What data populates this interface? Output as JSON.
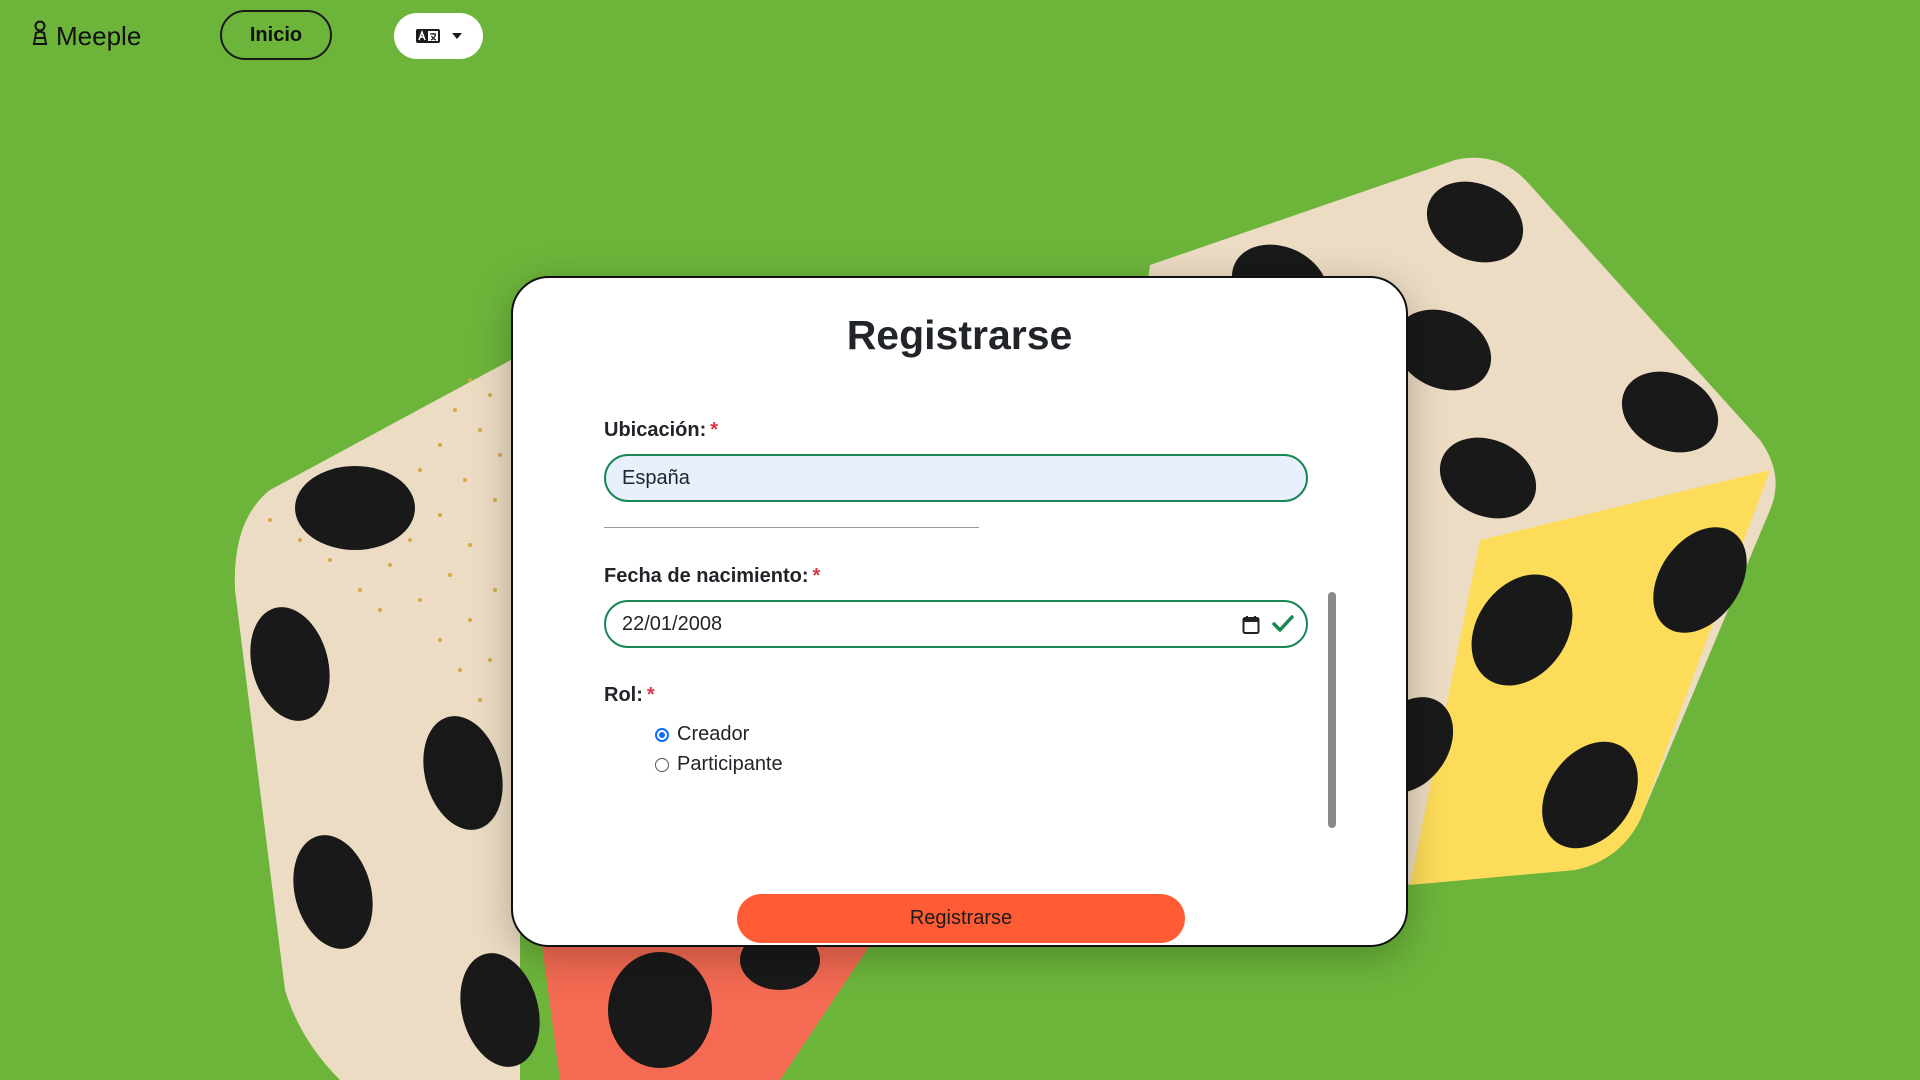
{
  "header": {
    "brand_name": "Meeple",
    "brand_icon": "meeple-icon",
    "home_label": "Inicio",
    "language_icon": "translate-icon"
  },
  "form": {
    "title": "Registrarse",
    "location_label": "Ubicación:",
    "location_value": "España",
    "birthdate_label": "Fecha de nacimiento:",
    "birthdate_value": "22/01/2008",
    "role_label": "Rol:",
    "role_options": [
      {
        "label": "Creador",
        "selected": true
      },
      {
        "label": "Participante",
        "selected": false
      }
    ],
    "required_mark": "*",
    "submit_label": "Registrarse"
  },
  "colors": {
    "background": "#6cb53a",
    "accent_button": "#ff5c35",
    "valid_border": "#198754",
    "required": "#dc3545"
  }
}
